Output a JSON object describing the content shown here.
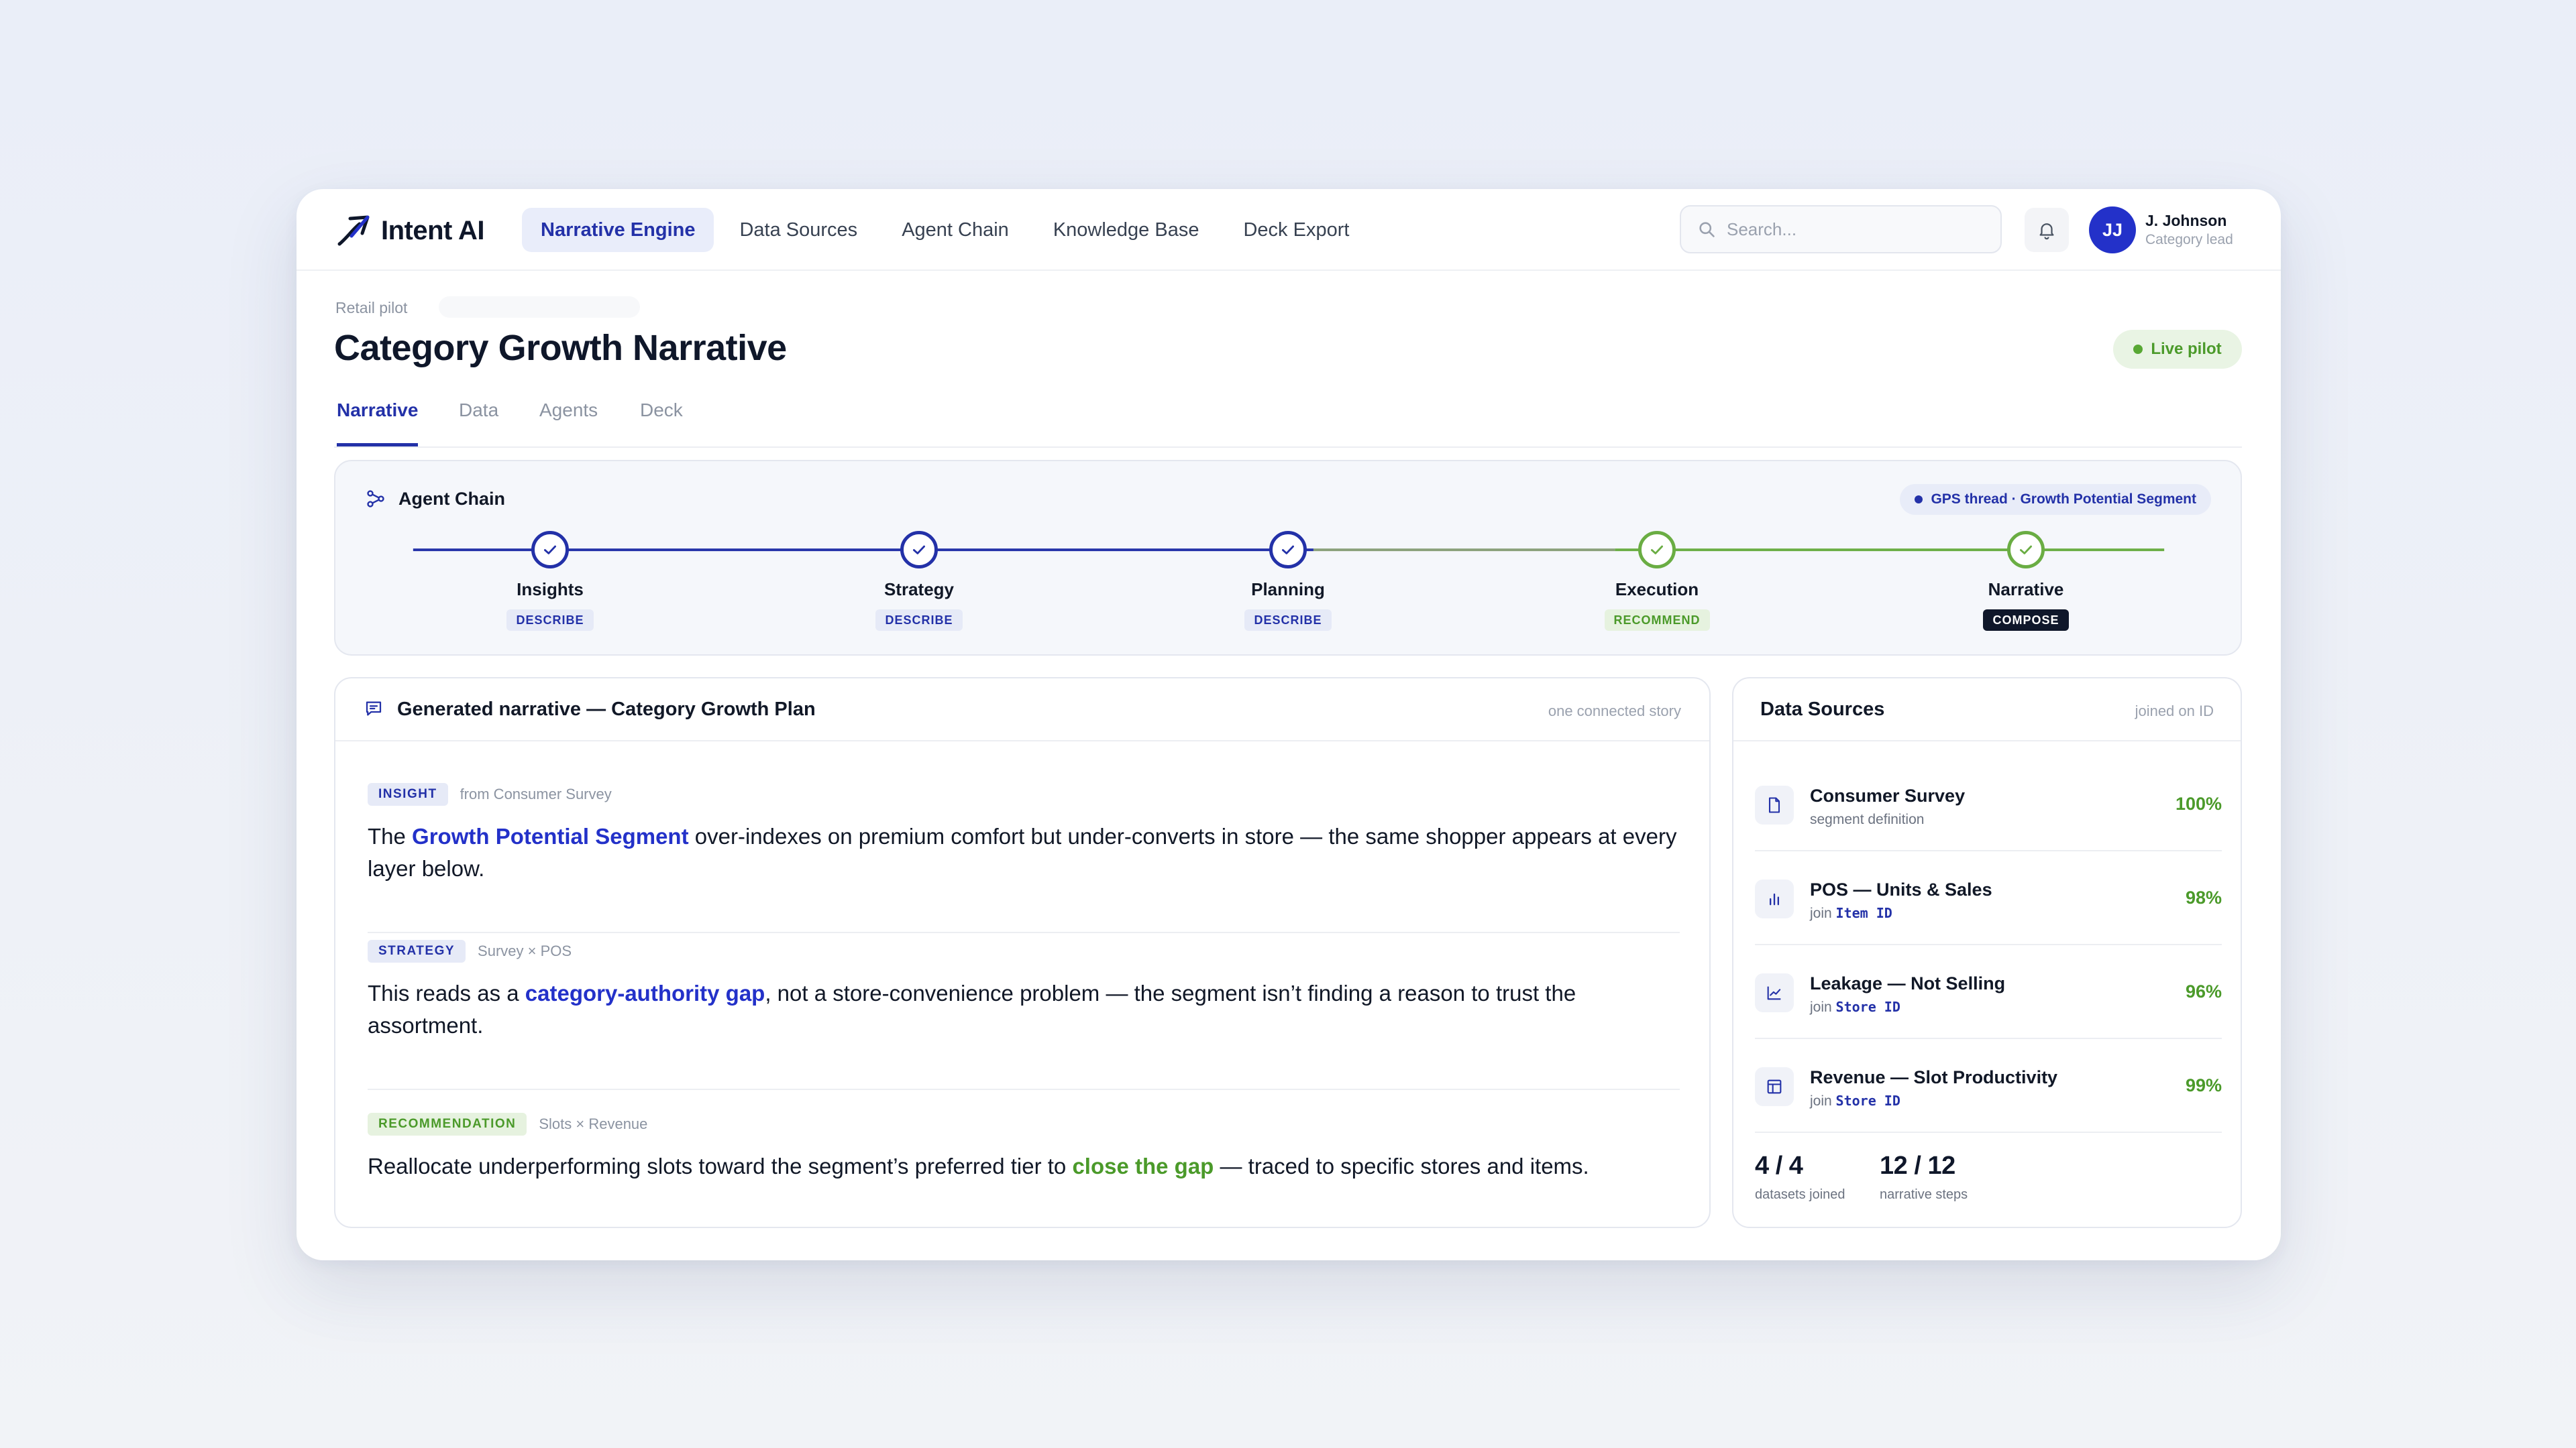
{
  "app": {
    "name": "Intent AI"
  },
  "nav": {
    "items": [
      {
        "label": "Narrative Engine",
        "active": true
      },
      {
        "label": "Data Sources"
      },
      {
        "label": "Agent Chain"
      },
      {
        "label": "Knowledge Base"
      },
      {
        "label": "Deck Export"
      }
    ]
  },
  "search": {
    "placeholder": "Search..."
  },
  "user": {
    "initials": "JJ",
    "name": "J. Johnson",
    "role": "Category lead"
  },
  "page": {
    "breadcrumb": "Retail pilot",
    "title": "Category Growth Narrative",
    "status": "Live pilot"
  },
  "tabs": [
    {
      "label": "Narrative",
      "active": true
    },
    {
      "label": "Data"
    },
    {
      "label": "Agents"
    },
    {
      "label": "Deck"
    }
  ],
  "agent_chain": {
    "title": "Agent Chain",
    "thread": "GPS thread · Growth Potential Segment",
    "steps": [
      {
        "label": "Insights",
        "tag": "DESCRIBE",
        "state": "blue"
      },
      {
        "label": "Strategy",
        "tag": "DESCRIBE",
        "state": "blue"
      },
      {
        "label": "Planning",
        "tag": "DESCRIBE",
        "state": "blue"
      },
      {
        "label": "Execution",
        "tag": "RECOMMEND",
        "state": "green"
      },
      {
        "label": "Narrative",
        "tag": "COMPOSE",
        "state": "green"
      }
    ]
  },
  "narrative": {
    "title": "Generated narrative — Category Growth Plan",
    "note": "one connected story",
    "blocks": [
      {
        "tag": "INSIGHT",
        "source": "from Consumer Survey",
        "pre": "The ",
        "highlight": "Growth Potential Segment",
        "post": " over-indexes on premium comfort but under-converts in store — the same shopper appears at every layer below."
      },
      {
        "tag": "STRATEGY",
        "source": "Survey × POS",
        "pre": "This reads as a ",
        "highlight": "category-authority gap",
        "post": ", not a store-convenience problem — the segment isn’t finding a reason to trust the assortment."
      },
      {
        "tag": "RECOMMENDATION",
        "source": "Slots × Revenue",
        "pre": "Reallocate underperforming slots toward the segment’s preferred tier to ",
        "highlight": "close the gap",
        "post": " — traced to specific stores and items."
      }
    ]
  },
  "data_sources": {
    "title": "Data Sources",
    "note": "joined on ID",
    "rows": [
      {
        "icon": "document-icon",
        "name": "Consumer Survey",
        "sub": "segment definition",
        "key": "",
        "pct": "100%"
      },
      {
        "icon": "bar-chart-icon",
        "name": "POS — Units & Sales",
        "sub": "join ",
        "key": "Item ID",
        "pct": "98%"
      },
      {
        "icon": "line-chart-icon",
        "name": "Leakage — Not Selling",
        "sub": "join ",
        "key": "Store ID",
        "pct": "96%"
      },
      {
        "icon": "layout-icon",
        "name": "Revenue — Slot Productivity",
        "sub": "join ",
        "key": "Store ID",
        "pct": "99%"
      }
    ],
    "stats": [
      {
        "value": "4 / 4",
        "label": "datasets joined"
      },
      {
        "value": "12 / 12",
        "label": "narrative steps"
      }
    ]
  },
  "colors": {
    "accent": "#2331a8",
    "success": "#4b9a2a",
    "success_line": "#6aad43"
  }
}
